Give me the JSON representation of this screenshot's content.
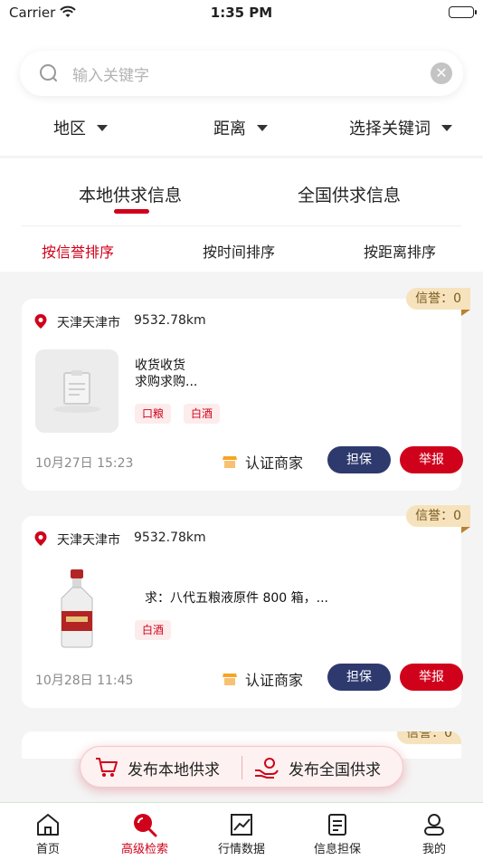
{
  "status_bar": {
    "carrier": "Carrier",
    "time": "1:35 PM"
  },
  "search": {
    "placeholder": "输入关键字"
  },
  "filters": [
    "地区",
    "距离",
    "选择关键词"
  ],
  "tabs": [
    "本地供求信息",
    "全国供求信息"
  ],
  "sort": [
    "按信誉排序",
    "按时间排序",
    "按距离排序"
  ],
  "cards": [
    {
      "badge": "信誉：0",
      "location": "天津天津市",
      "distance": "9532.78km",
      "title_line1": "收货收货",
      "title_line2": "求购求购...",
      "tags": [
        "口粮",
        "白酒"
      ],
      "date": "10月27日 15:23",
      "certified": "认证商家",
      "guarantee": "担保",
      "report": "举报"
    },
    {
      "badge": "信誉：0",
      "location": "天津天津市",
      "distance": "9532.78km",
      "title": "求：八代五粮液原件 800 箱，...",
      "tags": [
        "白酒"
      ],
      "date": "10月28日 11:45",
      "certified": "认证商家",
      "guarantee": "担保",
      "report": "举报"
    }
  ],
  "peek_badge": "信誉：0",
  "publish": {
    "local": "发布本地供求",
    "national": "发布全国供求"
  },
  "tabbar": [
    "首页",
    "高级检索",
    "行情数据",
    "信息担保",
    "我的"
  ],
  "colors": {
    "accent": "#d0021b",
    "navy": "#2e3a6e",
    "badge": "#f6e3bd"
  }
}
